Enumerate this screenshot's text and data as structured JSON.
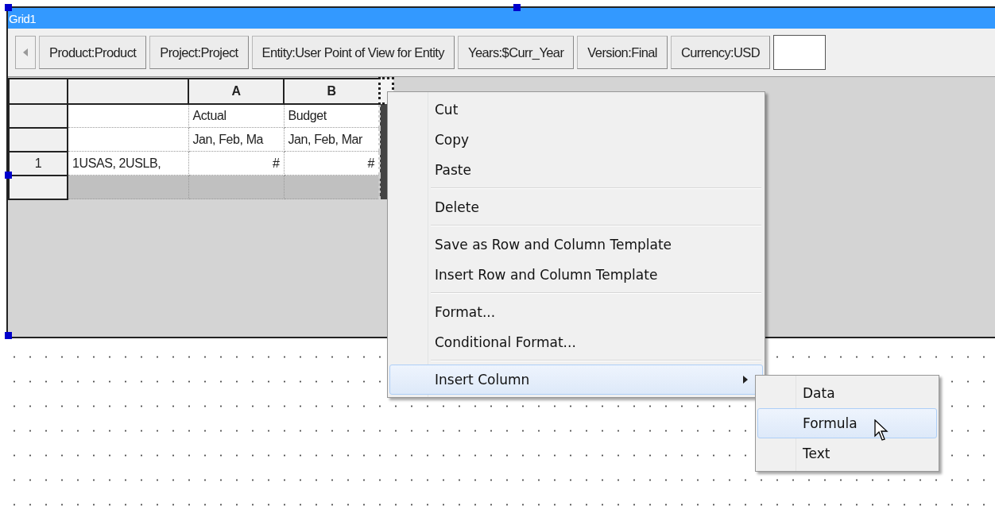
{
  "grid": {
    "title": "Grid1"
  },
  "toolbar": {
    "buttons": [
      "Product:Product",
      "Project:Project",
      "Entity:User Point of View for Entity",
      "Years:$Curr_Year",
      "Version:Final",
      "Currency:USD"
    ]
  },
  "table": {
    "columns": [
      "",
      "",
      "A",
      "B"
    ],
    "rows": [
      {
        "kind": "header",
        "cells": [
          "",
          "",
          "Actual",
          "Budget"
        ]
      },
      {
        "kind": "header",
        "cells": [
          "",
          "",
          "Jan, Feb, Ma",
          "Jan, Feb, Mar"
        ]
      },
      {
        "kind": "data",
        "cells": [
          "1",
          "1USAS, 2USLB,",
          "#",
          "#"
        ]
      },
      {
        "kind": "blank",
        "cells": [
          "",
          "",
          "",
          ""
        ]
      }
    ]
  },
  "context_menu": {
    "items": [
      {
        "kind": "item",
        "label": "Cut",
        "selected": false
      },
      {
        "kind": "item",
        "label": "Copy",
        "selected": false
      },
      {
        "kind": "item",
        "label": "Paste",
        "selected": false
      },
      {
        "kind": "separator"
      },
      {
        "kind": "item",
        "label": "Delete",
        "selected": false
      },
      {
        "kind": "separator"
      },
      {
        "kind": "item",
        "label": "Save as Row and Column Template",
        "selected": false
      },
      {
        "kind": "item",
        "label": "Insert Row and Column Template",
        "selected": false
      },
      {
        "kind": "separator"
      },
      {
        "kind": "item",
        "label": "Format...",
        "selected": false
      },
      {
        "kind": "item",
        "label": "Conditional Format...",
        "selected": false
      },
      {
        "kind": "separator"
      },
      {
        "kind": "submenu",
        "label": "Insert Column",
        "selected": true
      }
    ]
  },
  "submenu": {
    "items": [
      {
        "label": "Data",
        "selected": false
      },
      {
        "label": "Formula",
        "selected": true
      },
      {
        "label": "Text",
        "selected": false
      }
    ]
  }
}
